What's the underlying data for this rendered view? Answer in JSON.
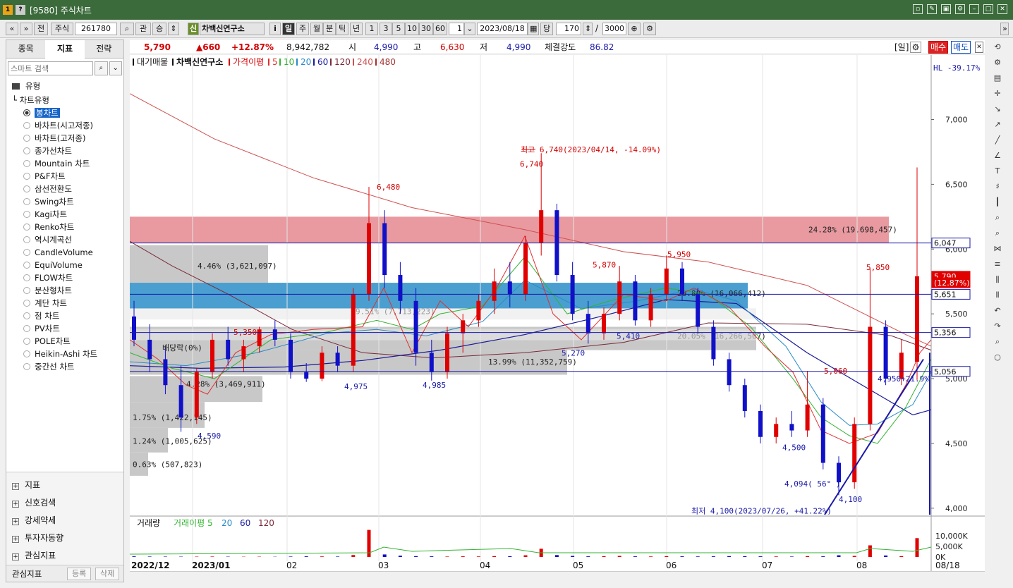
{
  "window": {
    "badge1": "1",
    "badge2": "?",
    "title": "[9580] 주식차트"
  },
  "toolbar": {
    "prev": "«",
    "down": "»",
    "jeon": "전",
    "market": "주식",
    "code": "261780",
    "gwan": "관",
    "sang": "승",
    "sin": "신",
    "name": "차백신연구소",
    "info": "i",
    "period": [
      "일",
      "주",
      "월",
      "분",
      "틱",
      "년"
    ],
    "intervals": [
      "1",
      "3",
      "5",
      "10",
      "30",
      "60"
    ],
    "count_small": "1",
    "date": "2023/08/18",
    "dang": "당",
    "bars": "170",
    "slash": "/",
    "total": "3000"
  },
  "sidebar": {
    "tabs": [
      "종목",
      "지표",
      "전략"
    ],
    "search_placeholder": "스마트 검색",
    "section": "유형",
    "group": "차트유형",
    "items": [
      "봉차트",
      "바차트(시고저종)",
      "바차트(고저종)",
      "종가선차트",
      "Mountain 차트",
      "P&F차트",
      "삼선전환도",
      "Swing차트",
      "Kagi차트",
      "Renko차트",
      "역시계곡선",
      "CandleVolume",
      "EquiVolume",
      "FLOW차트",
      "분산형차트",
      "계단 차트",
      "점 차트",
      "PV차트",
      "POLE차트",
      "Heikin-Ashi 차트",
      "중간선 차트"
    ],
    "groups": [
      "지표",
      "신호검색",
      "강세약세",
      "투자자동향",
      "관심지표"
    ],
    "footer": {
      "label": "관심지표",
      "register": "등록",
      "delete": "삭제"
    }
  },
  "quote": {
    "price": "5,790",
    "change": "▲660",
    "pct": "+12.87%",
    "volume": "8,942,782",
    "open_label": "시",
    "open": "4,990",
    "high_label": "고",
    "high": "6,630",
    "low_label": "저",
    "low": "4,990",
    "strength_label": "체결강도",
    "strength": "86.82",
    "day": "[일]",
    "buy": "매수",
    "sell": "매도"
  },
  "chart_data": {
    "type": "candlestick",
    "legend": {
      "prefix": "대기매물",
      "name": "차백신연구소",
      "ma_label": "가격이평",
      "ma_periods": [
        "5",
        "10",
        "20",
        "60",
        "120",
        "240",
        "480"
      ]
    },
    "hl_label": "HL -39.17%",
    "y_ticks": [
      "7,000",
      "6,500",
      "6,000",
      "5,500",
      "5,000",
      "4,500",
      "4,000"
    ],
    "y_range": [
      3950,
      7400
    ],
    "x_labels": [
      "2022/12",
      "2023/01",
      "02",
      "03",
      "04",
      "05",
      "06",
      "07",
      "08",
      "08/18"
    ],
    "price_boxes": [
      {
        "value": "6,047"
      },
      {
        "value": "5,790"
      },
      {
        "value": "(12.87%)"
      },
      {
        "value": "5,651"
      },
      {
        "value": "5,356"
      },
      {
        "value": "5,056"
      }
    ],
    "volume_profile": [
      {
        "label": "24.28% (19,698,457)"
      },
      {
        "label": "4.46% (3,621,097)"
      },
      {
        "label": "9.51% (7,713,223)"
      },
      {
        "label": "20.80% (16,066,412)"
      },
      {
        "label": "20.05% (16,266,507)"
      },
      {
        "label": "13.99% (11,352,759)"
      },
      {
        "label": "4.28% (3,469,911)"
      },
      {
        "label": "1.75% (1,422,145)"
      },
      {
        "label": "1.24% (1,005,625)"
      },
      {
        "label": "0.63% (507,823)"
      }
    ],
    "annotations": [
      "최고 6,740(2023/04/14, -14.09%)",
      "6,740",
      "6,480",
      "5,950",
      "5,870",
      "5,850",
      "5,350",
      "5,270",
      "5,060",
      "5,410",
      "4,975",
      "4,985",
      "4,590",
      "4,500",
      "4,100",
      "4,094( 56° )",
      "최저 4,100(2023/07/26, +41.22%)",
      "배당락(0%)",
      "4,950+21.9%"
    ],
    "volume_panel": {
      "label": "거래량",
      "ma_label": "거래이평",
      "ma_periods": [
        "5",
        "20",
        "60",
        "120"
      ],
      "ticks": [
        "10,000K",
        "5,000K",
        "0K"
      ]
    }
  }
}
